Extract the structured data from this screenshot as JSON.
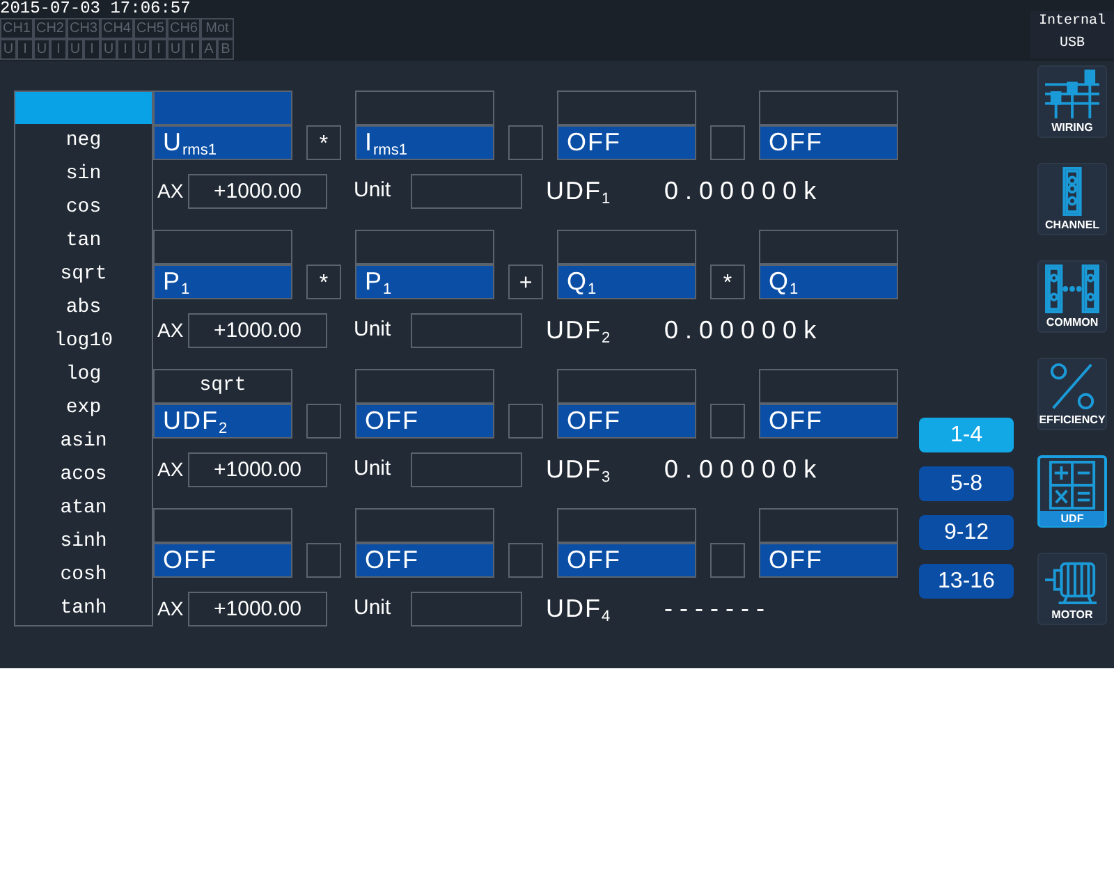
{
  "status_bar": {
    "datetime": "2015-07-03 17:06:57",
    "channels": [
      "CH1",
      "CH2",
      "CH3",
      "CH4",
      "CH5",
      "CH6",
      "Mot"
    ],
    "inputs": [
      "U",
      "I",
      "U",
      "I",
      "U",
      "I",
      "U",
      "I",
      "U",
      "I",
      "U",
      "I",
      "A",
      "B"
    ],
    "storage": [
      "Internal",
      "USB"
    ]
  },
  "function_menu": {
    "items": [
      {
        "kind": "blank",
        "selected": true
      },
      {
        "kind": "option",
        "label": "neg",
        "selected": false
      },
      {
        "kind": "option",
        "label": "sin",
        "selected": false
      },
      {
        "kind": "option",
        "label": "cos",
        "selected": false
      },
      {
        "kind": "option",
        "label": "tan",
        "selected": false
      },
      {
        "kind": "option",
        "label": "sqrt",
        "selected": false
      },
      {
        "kind": "option",
        "label": "abs",
        "selected": false
      },
      {
        "kind": "option",
        "label": "log10",
        "selected": false
      },
      {
        "kind": "option",
        "label": "log",
        "selected": false
      },
      {
        "kind": "option",
        "label": "exp",
        "selected": false
      },
      {
        "kind": "option",
        "label": "asin",
        "selected": false
      },
      {
        "kind": "option",
        "label": "acos",
        "selected": false
      },
      {
        "kind": "option",
        "label": "atan",
        "selected": false
      },
      {
        "kind": "option",
        "label": "sinh",
        "selected": false
      },
      {
        "kind": "option",
        "label": "cosh",
        "selected": false
      },
      {
        "kind": "option",
        "label": "tanh",
        "selected": false
      }
    ]
  },
  "udf_rows": [
    {
      "terms": [
        {
          "selected": true,
          "operand": "U$_{rms1}$"
        },
        {
          "operator": "*",
          "selected": false,
          "operand": "I$_{rms1}$"
        },
        {
          "selected": false,
          "operand": "OFF"
        },
        {
          "selected": false,
          "operand": "OFF"
        }
      ],
      "max_label": "AX",
      "max": "+1000.00",
      "unit_label": "Unit",
      "name": "UDF$_{1}$",
      "value": "0.00000k"
    },
    {
      "terms": [
        {
          "selected": false,
          "operand": "P$_{1}$"
        },
        {
          "operator": "*",
          "selected": false,
          "operand": "P$_{1}$"
        },
        {
          "operator": "+",
          "selected": false,
          "operand": "Q$_{1}$"
        },
        {
          "operator": "*",
          "selected": false,
          "operand": "Q$_{1}$"
        }
      ],
      "max_label": "AX",
      "max": "+1000.00",
      "unit_label": "Unit",
      "name": "UDF$_{2}$",
      "value": "0.00000k"
    },
    {
      "terms": [
        {
          "function": "sqrt",
          "selected": false,
          "operand": "UDF$_{2}$"
        },
        {
          "selected": false,
          "operand": "OFF"
        },
        {
          "selected": false,
          "operand": "OFF"
        },
        {
          "selected": false,
          "operand": "OFF"
        }
      ],
      "max_label": "AX",
      "max": "+1000.00",
      "unit_label": "Unit",
      "name": "UDF$_{3}$",
      "value": "0.00000k"
    },
    {
      "terms": [
        {
          "selected": false,
          "operand": "OFF"
        },
        {
          "selected": false,
          "operand": "OFF"
        },
        {
          "selected": false,
          "operand": "OFF"
        },
        {
          "selected": false,
          "operand": "OFF"
        }
      ],
      "max_label": "AX",
      "max": "+1000.00",
      "unit_label": "Unit",
      "name": "UDF$_{4}$",
      "value": "-------"
    }
  ],
  "page_tabs": [
    {
      "label": "1-4",
      "selected": true
    },
    {
      "label": "5-8",
      "selected": false
    },
    {
      "label": "9-12",
      "selected": false
    },
    {
      "label": "13-16",
      "selected": false
    }
  ],
  "sidebar": [
    {
      "kind": "wiring",
      "label": "WIRING",
      "selected": false
    },
    {
      "kind": "channel",
      "label": "CHANNEL",
      "selected": false
    },
    {
      "kind": "common",
      "label": "COMMON",
      "selected": false
    },
    {
      "kind": "efficiency",
      "label": "EFFICIENCY",
      "selected": false
    },
    {
      "kind": "udf",
      "label": "UDF",
      "selected": true
    },
    {
      "kind": "motor",
      "label": "MOTOR",
      "selected": false
    }
  ]
}
